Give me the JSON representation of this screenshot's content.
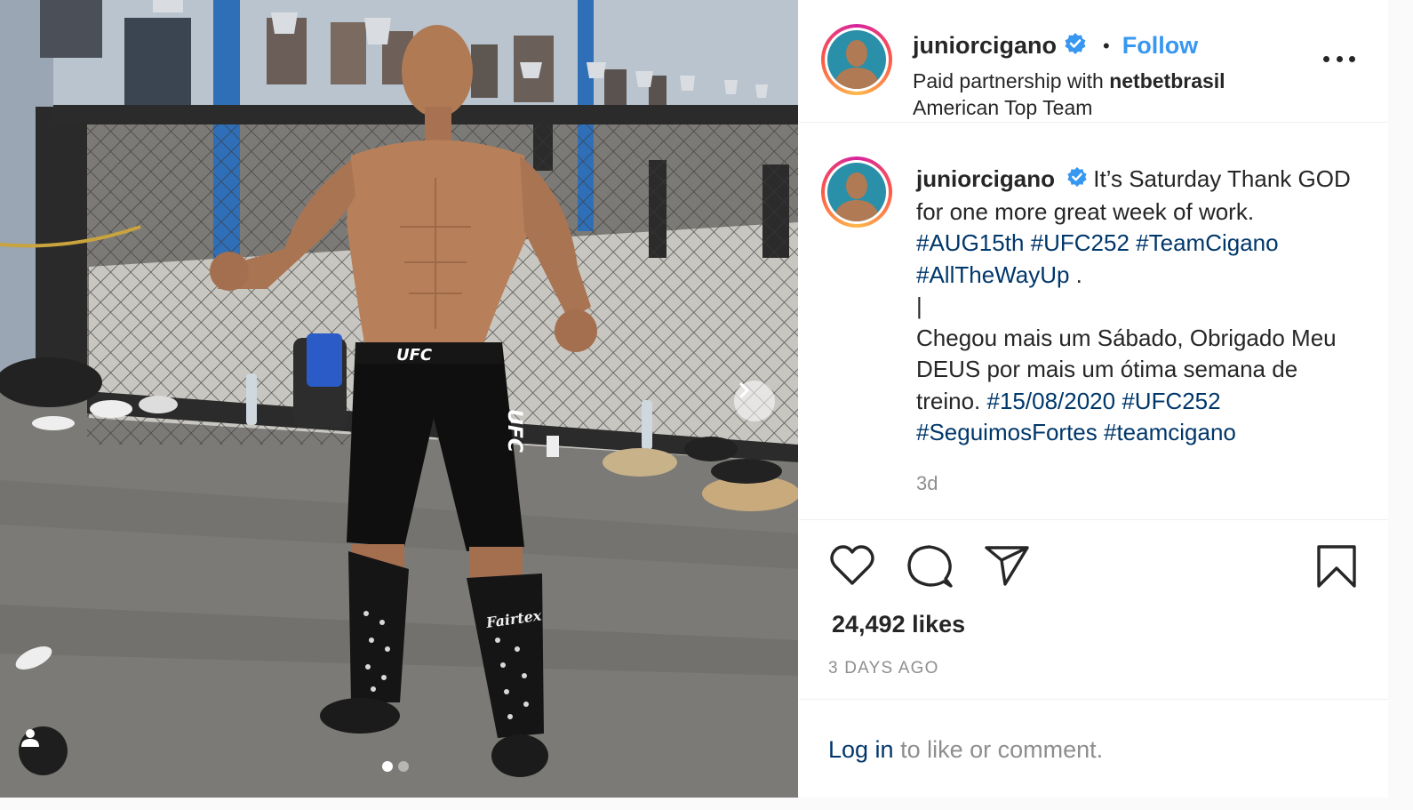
{
  "post": {
    "username": "juniorcigano",
    "follow_label": "Follow",
    "separator": "•",
    "partnership_prefix": "Paid partnership with",
    "partner": "netbetbrasil",
    "location": "American Top Team",
    "photo_alt": "Fighter posing in gym",
    "photo_text": {
      "shorts_waist": "UFC",
      "shorts_leg": "UFC",
      "guard_brand": "Fairtex"
    },
    "carousel": {
      "total": 2,
      "active": 1
    }
  },
  "caption": {
    "username": "juniorcigano",
    "text_1": "It’s Saturday Thank GOD for one more great week of work.",
    "tags_1": [
      "#AUG15th",
      "#UFC252",
      "#TeamCigano",
      "#AllTheWayUp"
    ],
    "text_1_end": ".",
    "divider": "|",
    "text_2": "Chegou mais um Sábado, Obrigado Meu DEUS por mais um ótima semana de treino.",
    "tags_2": [
      "#15/08/2020",
      "#UFC252",
      "#SeguimosFortes",
      "#teamcigano"
    ],
    "time_ago": "3d"
  },
  "engagement": {
    "likes": "24,492 likes",
    "date": "3 DAYS AGO"
  },
  "footer": {
    "login_link": "Log in",
    "login_rest": "to like or comment."
  },
  "colors": {
    "link_blue": "#3897f0",
    "hashtag": "#00376b",
    "verified": "#3897f0",
    "muted": "#8e8e8e"
  },
  "icons": [
    "more-options-icon",
    "verified-badge-icon",
    "heart-icon",
    "comment-icon",
    "share-icon",
    "bookmark-icon",
    "user-tag-icon",
    "chevron-right-icon"
  ]
}
